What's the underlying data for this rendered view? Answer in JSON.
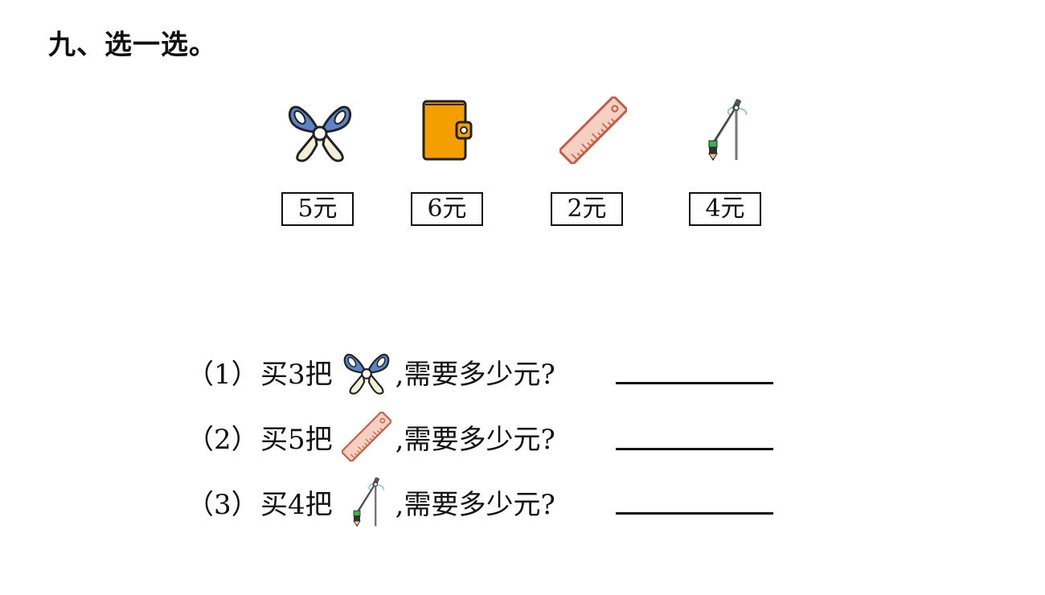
{
  "title": "九、选一选。",
  "items": [
    {
      "icon": "scissors-icon",
      "price": "5元"
    },
    {
      "icon": "wallet-icon",
      "price": "6元"
    },
    {
      "icon": "ruler-icon",
      "price": "2元"
    },
    {
      "icon": "compass-icon",
      "price": "4元"
    }
  ],
  "questions": [
    {
      "number": "（1）",
      "buy": "买3把",
      "icon": "scissors-icon",
      "ask": ",需要多少元?"
    },
    {
      "number": "（2）",
      "buy": "买5把",
      "icon": "ruler-icon",
      "ask": ",需要多少元?"
    },
    {
      "number": "（3）",
      "buy": "买4把",
      "icon": "compass-icon",
      "ask": ",需要多少元?"
    }
  ],
  "colors": {
    "scissors_blue": "#5b84c7",
    "scissors_cream": "#f3eed8",
    "wallet_orange": "#f59e00",
    "ruler_fill": "#f5cfc0",
    "ruler_stroke": "#c0604a",
    "compass_green": "#3bb54a"
  }
}
